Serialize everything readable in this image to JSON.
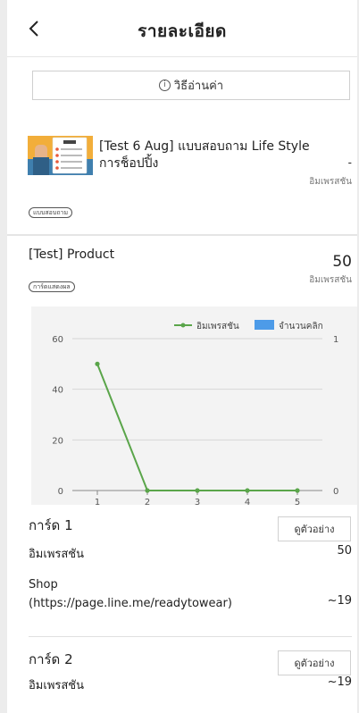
{
  "header": {
    "title": "รายละเอียด"
  },
  "howto": {
    "label": "วิธีอ่านค่า"
  },
  "survey": {
    "title": "[Test 6 Aug] แบบสอบถาม Life Style การช็อปปิ้ง",
    "value": "-",
    "metric": "อิมเพรสชัน",
    "tag": "แบบสอบถาม"
  },
  "product": {
    "name": "[Test] Product",
    "value": "50",
    "metric": "อิมเพรสชัน",
    "tag": "การ์ดแสดงผล"
  },
  "chart_data": {
    "type": "line",
    "x": [
      1,
      2,
      3,
      4,
      5
    ],
    "series": [
      {
        "name": "อิมเพรสชัน",
        "values": [
          50,
          0,
          0,
          0,
          0
        ],
        "color": "#5aa54a",
        "axis": "left"
      },
      {
        "name": "จำนวนคลิก",
        "values": [
          0,
          0,
          0,
          0,
          0
        ],
        "color": "#4d9be8",
        "axis": "right"
      }
    ],
    "y_left": {
      "ticks": [
        0,
        20,
        40,
        60
      ],
      "ylim": [
        0,
        60
      ]
    },
    "y_right": {
      "ticks": [
        0,
        1
      ],
      "ylim": [
        0,
        1
      ]
    },
    "legend_position": "top-right",
    "grid": true
  },
  "cards": [
    {
      "title": "การ์ด 1",
      "button": "ดูตัวอย่าง",
      "impressions_label": "อิมเพรสชัน",
      "impressions_value": "50",
      "link_label": "Shop",
      "link_url": "(https://page.line.me/readytowear)",
      "link_value": "~19"
    },
    {
      "title": "การ์ด 2",
      "button": "ดูตัวอย่าง",
      "impressions_label": "อิมเพรสชัน",
      "impressions_value": "~19"
    }
  ]
}
